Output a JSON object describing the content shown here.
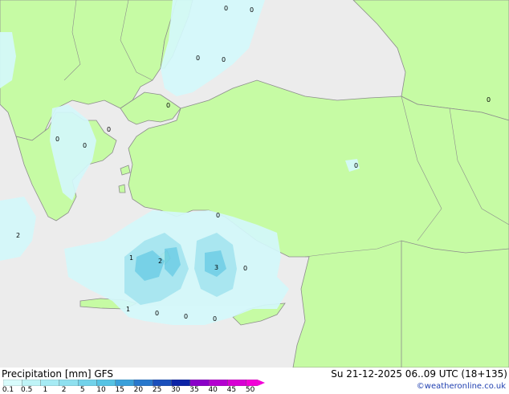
{
  "title": "Precipitation [mm] GFS",
  "datetime": "Su 21-12-2025 06..09 UTC (18+135)",
  "credit": "©weatheronline.co.uk",
  "legend": {
    "ticks": [
      "0.1",
      "0.5",
      "1",
      "2",
      "5",
      "10",
      "15",
      "20",
      "25",
      "30",
      "35",
      "40",
      "45",
      "50"
    ],
    "colors": [
      "#d8fbfb",
      "#bff4f7",
      "#a6ebf4",
      "#8ee0ef",
      "#72d2ea",
      "#56c3e4",
      "#3aa0da",
      "#2878cc",
      "#1a4fbb",
      "#0c23a6",
      "#8a00c8",
      "#b400d0",
      "#d800d4",
      "#f300d8"
    ]
  },
  "colors": {
    "land": "#c6fba4",
    "sea": "#ececec",
    "border": "#8c8c8c",
    "precip_light": "#d4f8fb",
    "precip_medium": "#a4e6f1",
    "precip_heavy": "#6ecfe7"
  },
  "contour_labels": [
    "0",
    "0",
    "0",
    "0",
    "0",
    "0",
    "0",
    "0",
    "0",
    "0",
    "0",
    "0",
    "2",
    "1",
    "2",
    "3",
    "1",
    "0",
    "0",
    "0"
  ]
}
